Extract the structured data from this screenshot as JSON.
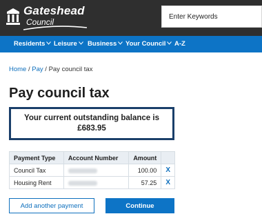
{
  "header": {
    "logo_name": "Gateshead",
    "logo_sub": "Council",
    "search_placeholder": "Enter Keywords"
  },
  "nav": {
    "items": [
      {
        "label": "Residents",
        "icon": "chevron-down-icon"
      },
      {
        "label": "Leisure",
        "icon": "chevron-down-icon"
      },
      {
        "label": "Business",
        "icon": "chevron-down-icon"
      },
      {
        "label": "Your Council",
        "icon": "chevron-down-icon"
      },
      {
        "label": "A-Z"
      }
    ]
  },
  "breadcrumb": {
    "items": [
      "Home",
      "Pay",
      "Pay council tax"
    ],
    "separator": "/"
  },
  "page_title": "Pay council tax",
  "balance": {
    "line1": "Your current outstanding balance is",
    "amount": "£683.95"
  },
  "table": {
    "headers": [
      "Payment Type",
      "Account Number",
      "Amount"
    ],
    "rows": [
      {
        "type": "Council Tax",
        "amount": "100.00",
        "remove": "X"
      },
      {
        "type": "Housing Rent",
        "amount": "57.25",
        "remove": "X"
      }
    ]
  },
  "buttons": {
    "add_payment": "Add another payment",
    "continue": "Continue"
  },
  "colors": {
    "header_bg": "#2f2f2f",
    "nav_bg": "#0d74c6",
    "link": "#0d6fbd",
    "balance_border": "#1a3f6a",
    "table_header_bg": "#e9eef3"
  }
}
